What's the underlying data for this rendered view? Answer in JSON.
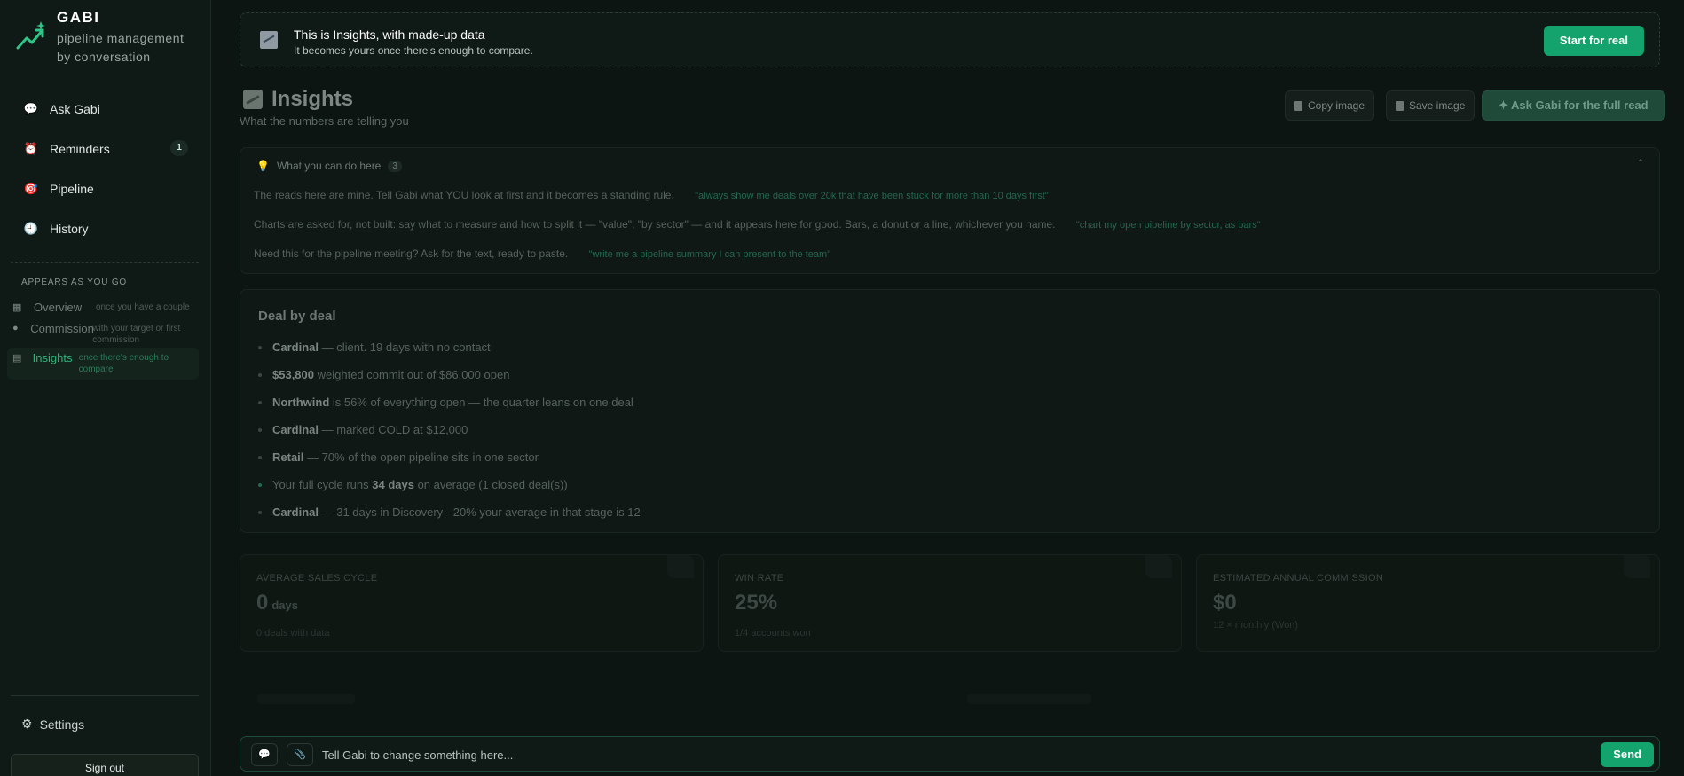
{
  "brand": {
    "name": "GABI",
    "tagline": "pipeline management by conversation"
  },
  "nav": [
    {
      "label": "Ask Gabi",
      "icon": "💬"
    },
    {
      "label": "Reminders",
      "icon": "⏰",
      "badge": "1"
    },
    {
      "label": "Pipeline",
      "icon": "🎯"
    },
    {
      "label": "History",
      "icon": "🕘"
    }
  ],
  "appears": {
    "title": "APPEARS AS YOU GO",
    "items": [
      {
        "label": "Overview",
        "hint": "once you have a couple",
        "icon": "▦"
      },
      {
        "label": "Commission",
        "hint": "with your target or first commission",
        "icon": "●"
      },
      {
        "label": "Insights",
        "hint": "once there's enough to compare",
        "icon": "▤"
      }
    ]
  },
  "settings": "Settings",
  "signout": "Sign out",
  "banner": {
    "title": "This is Insights, with made-up data",
    "subtitle": "It becomes yours once there's enough to compare.",
    "button": "Start for real"
  },
  "page": {
    "title": "Insights",
    "subtitle": "What the numbers are telling you"
  },
  "actions": {
    "copy": "Copy image",
    "save": "Save image",
    "ask": "✦ Ask Gabi for the full read"
  },
  "help": {
    "title": "What you can do here",
    "count": "3",
    "collapse": "⌃",
    "rows": [
      {
        "text": "The reads here are mine. Tell Gabi what YOU look at first and it becomes a standing rule.",
        "quote": "\"always show me deals over 20k that have been stuck for more than 10 days first\""
      },
      {
        "text": "Charts are asked for, not built: say what to measure and how to split it — \"value\", \"by sector\" — and it appears here for good. Bars, a donut or a line, whichever you name.",
        "quote": "\"chart my open pipeline by sector, as bars\""
      },
      {
        "text": "Need this for the pipeline meeting? Ask for the text, ready to paste.",
        "quote": "\"write me a pipeline summary I can present to the team\""
      }
    ]
  },
  "deals": {
    "title": "Deal by deal",
    "items": [
      {
        "bold": "Cardinal",
        "text": " — client. 19 days with no contact"
      },
      {
        "bold": "$53,800",
        "text": " weighted commit out of $86,000 open"
      },
      {
        "bold": "Northwind",
        "text": " is 56% of everything open — the quarter leans on one deal"
      },
      {
        "bold": "Cardinal",
        "text": " — marked COLD at $12,000"
      },
      {
        "bold": "Retail",
        "text": " — 70% of the open pipeline sits in one sector"
      },
      {
        "pre": "Your full cycle runs ",
        "bold": "34 days",
        "text": " on average (1 closed deal(s))"
      },
      {
        "bold": "Cardinal",
        "text": " — 31 days in Discovery - 20% your average in that stage is 12"
      }
    ]
  },
  "stats": [
    {
      "label": "AVERAGE SALES CYCLE",
      "value": "0",
      "unit": "days",
      "note": "0 deals with data"
    },
    {
      "label": "WIN RATE",
      "value": "25%",
      "unit": "",
      "note": "1/4 accounts won"
    },
    {
      "label": "ESTIMATED ANNUAL COMMISSION",
      "value": "$0",
      "unit": "",
      "note": "12 × monthly (Won)"
    }
  ],
  "chat": {
    "placeholder": "Tell Gabi to change something here...",
    "send": "Send",
    "chat_icon": "💬",
    "attach_icon": "📎"
  },
  "colors": {
    "accent": "#14a36c",
    "background": "#0d1512",
    "sidebar": "#0f1915"
  }
}
